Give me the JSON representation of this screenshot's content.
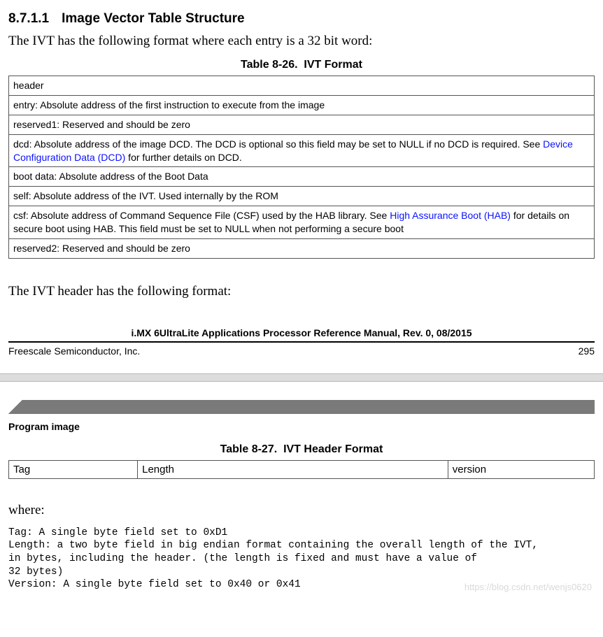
{
  "section": {
    "number": "8.7.1.1",
    "title": "Image Vector Table Structure"
  },
  "intro1": "The IVT has the following format where each entry is a 32 bit word:",
  "table26": {
    "caption_label": "Table 8-26.",
    "caption_title": "IVT Format",
    "rows": [
      {
        "text": "header"
      },
      {
        "text": "entry: Absolute address of the first instruction to execute from the image"
      },
      {
        "text": "reserved1: Reserved and should be zero"
      },
      {
        "pre": "dcd: Absolute address of the image DCD. The DCD is optional so this field may be set to NULL if no DCD is required. See ",
        "link": "Device Configuration Data (DCD)",
        "post": " for further details on DCD."
      },
      {
        "text": "boot data: Absolute address of the Boot Data"
      },
      {
        "text": "self: Absolute address of the IVT. Used internally by the ROM"
      },
      {
        "pre": "csf: Absolute address of Command Sequence File (CSF) used by the HAB library. See ",
        "link": "High Assurance Boot (HAB)",
        "post": " for details on secure boot using HAB. This field must be set to NULL when not performing a secure boot"
      },
      {
        "text": "reserved2: Reserved and should be zero"
      }
    ]
  },
  "intro2": "The IVT header has the following format:",
  "footer": {
    "doc_title": "i.MX 6UltraLite Applications Processor Reference Manual, Rev. 0, 08/2015",
    "company": "Freescale Semiconductor, Inc.",
    "page_no": "295"
  },
  "page2": {
    "section_label": "Program image",
    "table27": {
      "caption_label": "Table 8-27.",
      "caption_title": "IVT Header Format",
      "cols": [
        "Tag",
        "Length",
        "version"
      ]
    },
    "where": "where:",
    "defs": "Tag: A single byte field set to 0xD1\nLength: a two byte field in big endian format containing the overall length of the IVT,\nin bytes, including the header. (the length is fixed and must have a value of\n32 bytes)\nVersion: A single byte field set to 0x40 or 0x41"
  },
  "watermark": "https://blog.csdn.net/wenjs0620"
}
